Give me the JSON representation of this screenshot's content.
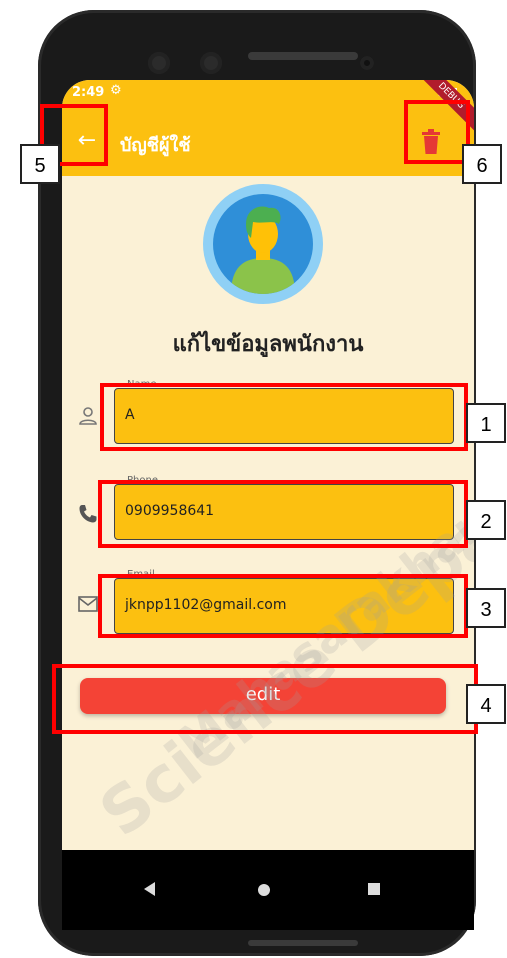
{
  "status_bar": {
    "time": "2:49"
  },
  "app_bar": {
    "title": "บัญชีผู้ใช้",
    "debug_ribbon": "DEBUG"
  },
  "heading": "แก้ไขข้อมูลพนักงาน",
  "form": {
    "fields": [
      {
        "label": "Name",
        "value": "A",
        "icon": "person-icon"
      },
      {
        "label": "Phone",
        "value": "0909958641",
        "icon": "phone-icon"
      },
      {
        "label": "Email",
        "value": "jknpp1102@gmail.com",
        "icon": "mail-icon"
      }
    ],
    "edit_label": "edit"
  },
  "annotations": [
    "1",
    "2",
    "3",
    "4",
    "5",
    "6"
  ],
  "watermark": {
    "line1": "Science Department",
    "line2": "Mahasarakham"
  },
  "colors": {
    "accent": "#fcc010",
    "background": "#fbf1d6",
    "button": "#f44336",
    "highlight": "#ff0000"
  }
}
